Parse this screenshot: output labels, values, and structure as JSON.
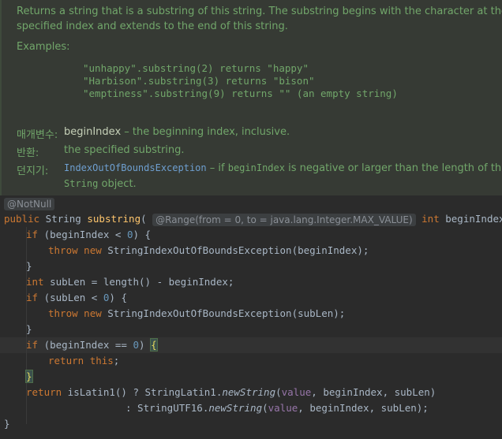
{
  "doc": {
    "summary1": "Returns a string that is a substring of this string. The substring begins with the character at the",
    "summary2": "specified index and extends to the end of this string.",
    "examples_label": "Examples:",
    "example1": "\"unhappy\".substring(2) returns \"happy\"",
    "example2": "\"Harbison\".substring(3) returns \"bison\"",
    "example3": "\"emptiness\".substring(9) returns \"\" (an empty string)",
    "params_label": "매개변수:",
    "param_name": "beginIndex",
    "param_desc": " – the beginning index, inclusive.",
    "returns_label": "반환:",
    "returns_desc": "the specified substring.",
    "throws_label": "던지기:",
    "throws_exception": "IndexOutOfBoundsException",
    "throws_desc_a": " – if ",
    "throws_code": "beginIndex",
    "throws_desc_b": " is negative or larger than the length of this",
    "throws_code2": "String",
    "throws_desc_c": " object."
  },
  "code": {
    "annotation": "@NotNull",
    "l1_kw": "public",
    "l1_type": " String ",
    "l1_fn": "substring",
    "l1_paren": "(",
    "l1_range": "@Range(from = 0, to = java.lang.Integer.MAX_VALUE)",
    "l1_int": "int",
    "l1_rest": " beginIndex) {",
    "l2_if": "if",
    "l2_a": " (beginIndex < ",
    "l2_num": "0",
    "l2_b": ") {",
    "l3_throw": "throw",
    "l3_new": "new",
    "l3_rest": " StringIndexOutOfBoundsException(beginIndex);",
    "l4": "}",
    "l5_int": "int",
    "l5_rest": " subLen = length() - beginIndex;",
    "l6_if": "if",
    "l6_a": " (subLen < ",
    "l6_num": "0",
    "l6_b": ") {",
    "l7_throw": "throw",
    "l7_new": "new",
    "l7_rest": " StringIndexOutOfBoundsException(subLen);",
    "l8": "}",
    "l9_if": "if",
    "l9_a": " (beginIndex == ",
    "l9_num": "0",
    "l9_b": ") ",
    "l9_brace": "{",
    "l10_return": "return",
    "l10_this": "this",
    "l10_semi": ";",
    "l11_brace": "}",
    "l12_return": "return",
    "l12_a": " isLatin1() ? StringLatin1.",
    "l12_fn": "newString",
    "l12_b": "(",
    "l12_value": "value",
    "l12_c": ", beginIndex, subLen)",
    "l13_a": ": StringUTF16.",
    "l13_fn": "newString",
    "l13_b": "(",
    "l13_value": "value",
    "l13_c": ", beginIndex, subLen);",
    "l14": "}"
  }
}
